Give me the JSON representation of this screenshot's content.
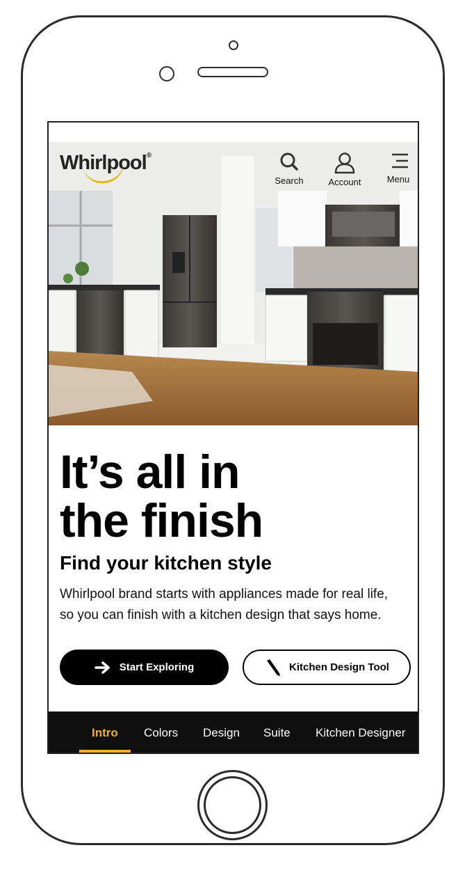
{
  "header": {
    "brand": "Whirlpool",
    "brand_mark": "®",
    "nav": [
      {
        "label": "Search",
        "icon": "search-icon"
      },
      {
        "label": "Account",
        "icon": "user-icon"
      },
      {
        "label": "Menu",
        "icon": "menu-icon"
      }
    ]
  },
  "hero": {
    "headline_line1": "It’s all in",
    "headline_line2": "the finish",
    "subhead": "Find your kitchen style",
    "body_line1": "Whirlpool brand starts with appliances made for real life,",
    "body_line2": "so you can finish with a kitchen design that says home."
  },
  "cta": {
    "primary_label": "Start Exploring",
    "primary_icon": "arrow-right-icon",
    "secondary_label": "Kitchen Design Tool",
    "secondary_icon": "pencil-icon"
  },
  "tabs": [
    {
      "label": "Intro",
      "active": true
    },
    {
      "label": "Colors",
      "active": false
    },
    {
      "label": "Design",
      "active": false
    },
    {
      "label": "Suite",
      "active": false
    },
    {
      "label": "Kitchen Designer",
      "active": false
    }
  ],
  "colors": {
    "accent": "#f3b31e",
    "button_dark": "#000000",
    "tabbar_bg": "#0f0f0f"
  }
}
